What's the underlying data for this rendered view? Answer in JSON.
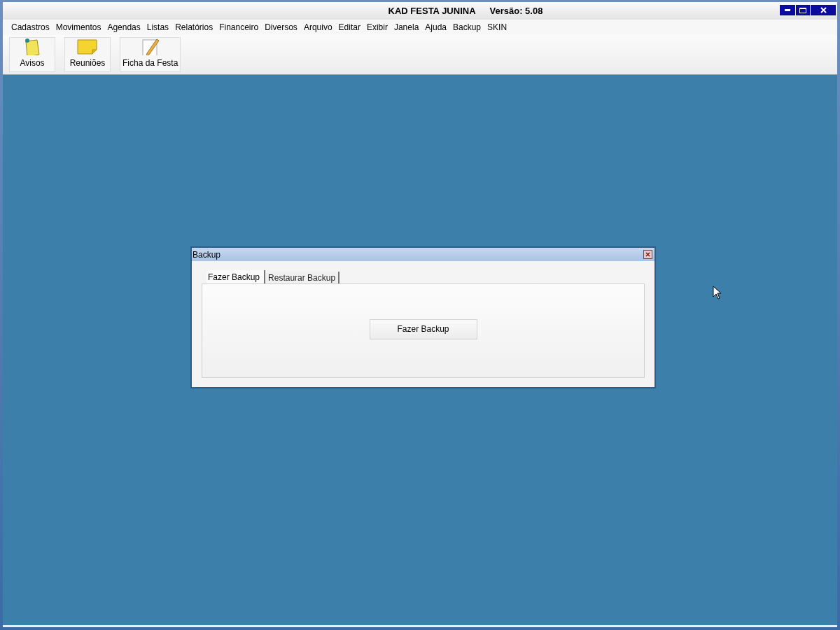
{
  "window": {
    "title": "KAD FESTA JUNINA",
    "version": "Versão: 5.08"
  },
  "menu": [
    "Cadastros",
    "Movimentos",
    "Agendas",
    "Listas",
    "Relatórios",
    "Financeiro",
    "Diversos",
    "Arquivo",
    "Editar",
    "Exibir",
    "Janela",
    "Ajuda",
    "Backup",
    "SKIN"
  ],
  "toolbar": [
    {
      "label": "Avisos",
      "kind": "pinned-note"
    },
    {
      "label": "Reuniões",
      "kind": "note"
    },
    {
      "label": "Ficha da Festa",
      "kind": "pencil-sheet"
    }
  ],
  "dialog": {
    "title": "Backup",
    "tabs": [
      {
        "label": "Fazer Backup",
        "selected": true
      },
      {
        "label": "Restaurar Backup",
        "selected": false
      }
    ],
    "button": "Fazer Backup"
  }
}
